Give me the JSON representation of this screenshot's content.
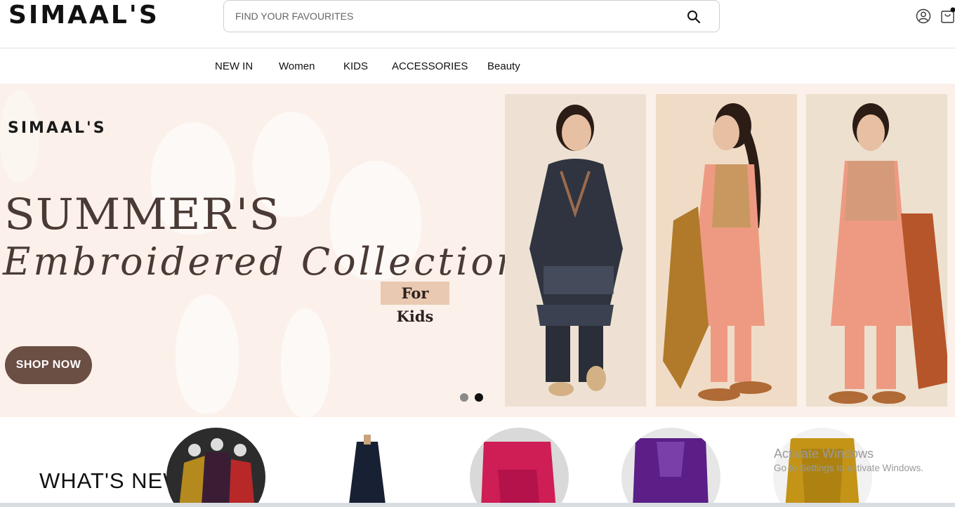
{
  "header": {
    "logo": "SIMAAL'S",
    "search_placeholder": "FIND YOUR FAVOURITES",
    "icons": [
      "search-icon",
      "user-icon",
      "cart-icon"
    ]
  },
  "nav": {
    "items": [
      {
        "label": "NEW IN"
      },
      {
        "label": "Women"
      },
      {
        "label": "KIDS"
      },
      {
        "label": "ACCESSORIES"
      },
      {
        "label": "Beauty"
      }
    ]
  },
  "hero": {
    "brand": "SIMAAL'S",
    "title": "SUMMER'S",
    "script": "Embroidered Collection",
    "tag": "For Kids",
    "button": "SHOP NOW",
    "slides": 2,
    "active_slide": 2
  },
  "categories": {
    "heading": "WHAT'S NEW"
  },
  "system": {
    "activate_title": "Activate Windows",
    "activate_sub": "Go to Settings to activate Windows."
  },
  "colors": {
    "hero_bg": "#fbf1ea",
    "button_bg": "#6b4e44",
    "tag_bg": "#e9c9b1",
    "text_brown": "#4a3a35"
  }
}
